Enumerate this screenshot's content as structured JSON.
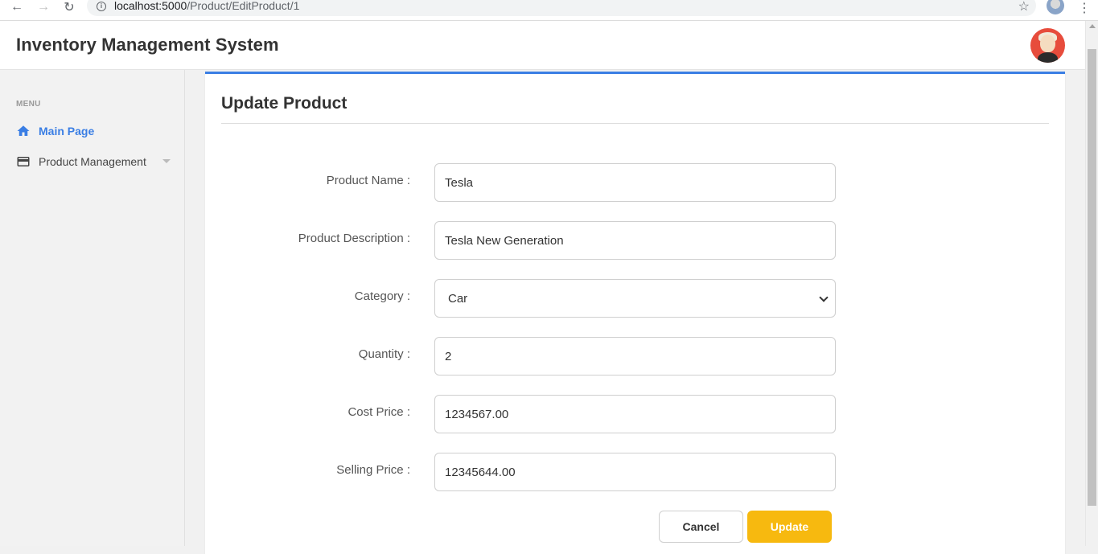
{
  "browser": {
    "url_host": "localhost:5000",
    "url_path": "/Product/EditProduct/1",
    "back_glyph": "←",
    "forward_glyph": "→",
    "reload_glyph": "↻",
    "star_glyph": "☆",
    "menu_glyph": "⋮"
  },
  "header": {
    "title": "Inventory Management System"
  },
  "sidebar": {
    "menu_label": "MENU",
    "items": [
      {
        "label": "Main Page",
        "icon": "home-icon",
        "active": true
      },
      {
        "label": "Product Management",
        "icon": "credit-card-icon",
        "active": false
      }
    ]
  },
  "form": {
    "title": "Update Product",
    "fields": [
      {
        "label": "Product Name :",
        "value": "Tesla"
      },
      {
        "label": "Product Description :",
        "value": "Tesla New Generation"
      },
      {
        "label": "Category :",
        "value": "Car"
      },
      {
        "label": "Quantity :",
        "value": "2"
      },
      {
        "label": "Cost Price :",
        "value": "1234567.00"
      },
      {
        "label": "Selling Price :",
        "value": "12345644.00"
      }
    ],
    "cancel_label": "Cancel",
    "update_label": "Update"
  },
  "colors": {
    "accent": "#3a7ee4",
    "update_button": "#f7b90f",
    "avatar_bg": "#e74c3c"
  }
}
